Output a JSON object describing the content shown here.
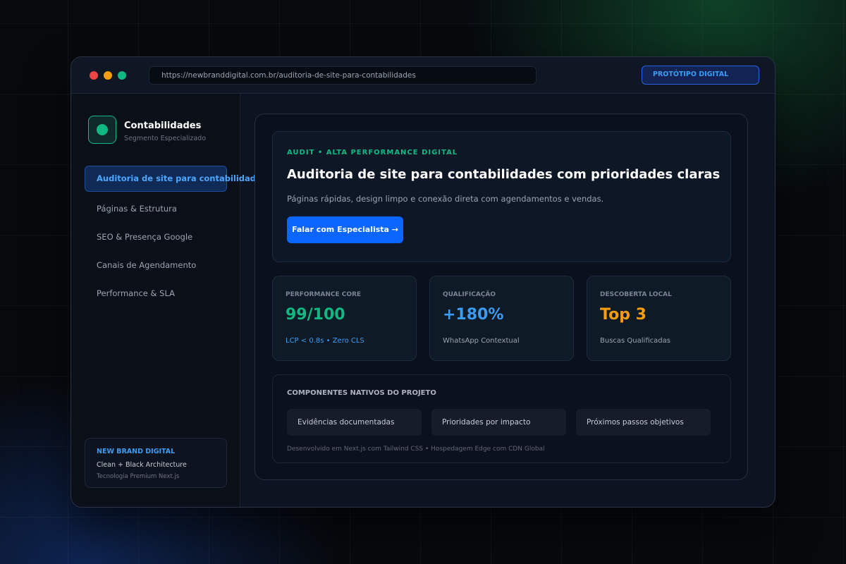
{
  "browser": {
    "url": "https://newbranddigital.com.br/auditoria-de-site-para-contabilidades",
    "badge": "PROTÓTIPO DIGITAL"
  },
  "sidebar": {
    "brand_name": "Contabilidades",
    "brand_sub": "Segmento Especializado",
    "items": [
      {
        "label": "Auditoria de site para contabilidades",
        "active": true
      },
      {
        "label": "Páginas & Estrutura",
        "active": false
      },
      {
        "label": "SEO & Presença Google",
        "active": false
      },
      {
        "label": "Canais de Agendamento",
        "active": false
      },
      {
        "label": "Performance & SLA",
        "active": false
      }
    ],
    "card": {
      "title": "NEW BRAND DIGITAL",
      "line1": "Clean + Black Architecture",
      "line2": "Tecnologia Premium Next.js"
    }
  },
  "hero": {
    "eyebrow": "AUDIT • ALTA PERFORMANCE DIGITAL",
    "title": "Auditoria de site para contabilidades com prioridades claras",
    "description": "Páginas rápidas, design limpo e conexão direta com agendamentos e vendas.",
    "cta": "Falar com Especialista →"
  },
  "metrics": [
    {
      "label": "PERFORMANCE CORE",
      "value": "99/100",
      "sub": "LCP < 0.8s • Zero CLS",
      "value_color": "#10b981",
      "sub_color": "#3b9cf6"
    },
    {
      "label": "QUALIFICAÇÃO",
      "value": "+180%",
      "sub": "WhatsApp Contextual",
      "value_color": "#3b9cf6",
      "sub_color": "#9aa4b2"
    },
    {
      "label": "DESCOBERTA LOCAL",
      "value": "Top 3",
      "sub": "Buscas Qualificadas",
      "value_color": "#f59e0b",
      "sub_color": "#9aa4b2"
    }
  ],
  "components": {
    "heading": "COMPONENTES NATIVOS DO PROJETO",
    "chips": [
      "Evidências documentadas",
      "Prioridades por impacto",
      "Próximos passos objetivos"
    ],
    "footnote": "Desenvolvido em Next.js com Tailwind CSS • Hospedagem Edge com CDN Global"
  },
  "colors": {
    "accent_blue": "#0a66ff",
    "accent_green": "#10b981",
    "accent_orange": "#f59e0b"
  }
}
